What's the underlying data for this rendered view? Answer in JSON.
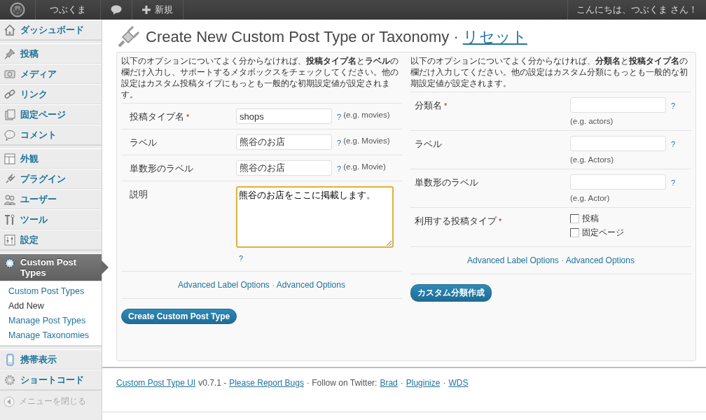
{
  "admin_bar": {
    "site": "つぶくま",
    "new_label": "新規",
    "greeting": "こんにちは、つぶくま さん！"
  },
  "sidebar": {
    "groups": [
      {
        "items": [
          {
            "label": "ダッシュボード",
            "selected": false
          }
        ]
      },
      {
        "items": [
          {
            "label": "投稿",
            "selected": false
          },
          {
            "label": "メディア",
            "selected": false
          },
          {
            "label": "リンク",
            "selected": false
          },
          {
            "label": "固定ページ",
            "selected": false
          },
          {
            "label": "コメント",
            "selected": false
          }
        ]
      },
      {
        "items": [
          {
            "label": "外観",
            "selected": false
          },
          {
            "label": "プラグイン",
            "selected": false
          },
          {
            "label": "ユーザー",
            "selected": false
          },
          {
            "label": "ツール",
            "selected": false
          },
          {
            "label": "設定",
            "selected": false
          }
        ]
      },
      {
        "items": [
          {
            "label": "Custom Post Types",
            "selected": true,
            "children": [
              {
                "label": "Custom Post Types",
                "selected": false
              },
              {
                "label": "Add New",
                "selected": true
              },
              {
                "label": "Manage Post Types",
                "selected": false
              },
              {
                "label": "Manage Taxonomies",
                "selected": false
              }
            ]
          }
        ]
      },
      {
        "items": [
          {
            "label": "携帯表示",
            "selected": false
          },
          {
            "label": "ショートコード",
            "selected": false
          }
        ]
      }
    ],
    "collapse_label": "メニューを閉じる"
  },
  "page": {
    "title": "Create New Custom Post Type or Taxonomy",
    "separator": "·",
    "reset_link": "リセット"
  },
  "post_type_panel": {
    "intro": "以下のオプションについてよく分からなければ、**投稿タイプ名**と**ラベル**の欄だけ入力し、サポートするメタボックスをチェックしてください。他の設定はカスタム投稿タイプにもっとも一般的な初期設定値が設定されます。",
    "fields": [
      {
        "kind": "text",
        "label": "投稿タイプ名",
        "required_mark": "*",
        "value": "shops",
        "help": "?",
        "example": "(e.g. movies)"
      },
      {
        "kind": "text",
        "label": "ラベル",
        "value": "熊谷のお店",
        "help": "?",
        "example": "(e.g. Movies)"
      },
      {
        "kind": "text",
        "label": "単数形のラベル",
        "value": "熊谷のお店",
        "help": "?",
        "example": "(e.g. Movie)"
      },
      {
        "kind": "textarea",
        "label": "説明",
        "value": "熊谷のお店をここに掲載します。",
        "focused": true,
        "help": "?"
      }
    ],
    "links": [
      "Advanced Label Options",
      "Advanced Options"
    ],
    "links_separator": "·",
    "button": "Create Custom Post Type"
  },
  "taxonomy_panel": {
    "intro": "以下のオプションについてよく分からなければ、**分類名**と**投稿タイプ名**の欄だけ入力してください。他の設定はカスタム分類にもっとも一般的な初期設定値が設定されます。",
    "fields": [
      {
        "kind": "text",
        "label": "分類名",
        "required_mark": "*",
        "help": "?",
        "example": "(e.g. actors)"
      },
      {
        "kind": "text",
        "label": "ラベル",
        "help": "?",
        "example": "(e.g. Actors)"
      },
      {
        "kind": "text",
        "label": "単数形のラベル",
        "help": "?",
        "example": "(e.g. Actor)"
      },
      {
        "kind": "checkboxes",
        "label": "利用する投稿タイプ",
        "required_mark": "*",
        "options": [
          {
            "label": "投稿",
            "checked": false
          },
          {
            "label": "固定ページ",
            "checked": false
          }
        ]
      }
    ],
    "links": [
      "Advanced Label Options",
      "Advanced Options"
    ],
    "links_separator": "·",
    "button": "カスタム分類作成"
  },
  "footer": {
    "plugin_link": "Custom Post Type UI",
    "version": "v0.7.1 -",
    "bugs_link": "Please Report Bugs",
    "follow_text": "· Follow on Twitter:",
    "twitter_links": [
      "Brad",
      "Pluginize",
      "WDS"
    ],
    "separator": "·"
  }
}
